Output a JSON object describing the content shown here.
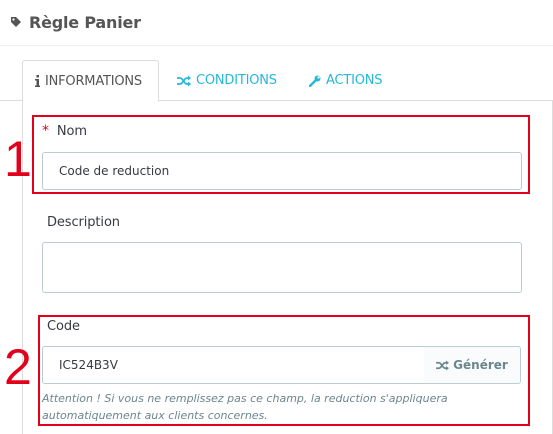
{
  "header": {
    "title": "Règle Panier",
    "icon": "tag-icon"
  },
  "tabs": [
    {
      "label": "INFORMATIONS",
      "icon": "info-icon",
      "active": true
    },
    {
      "label": "CONDITIONS",
      "icon": "random-icon",
      "active": false
    },
    {
      "label": "ACTIONS",
      "icon": "wrench-icon",
      "active": false
    }
  ],
  "form": {
    "name": {
      "required_mark": "*",
      "label": "Nom",
      "value": "Code de reduction"
    },
    "description": {
      "label": "Description",
      "value": ""
    },
    "code": {
      "label": "Code",
      "value": "IC524B3V",
      "generate_label": "Générer",
      "help": "Attention ! Si vous ne remplissez pas ce champ, la reduction s'appliquera automatiquement aux clients concernes."
    }
  },
  "annotations": {
    "first": "1",
    "second": "2"
  },
  "colors": {
    "accent": "#25b9d7",
    "annotation": "#e2001a",
    "border": "#bbcdd2"
  }
}
